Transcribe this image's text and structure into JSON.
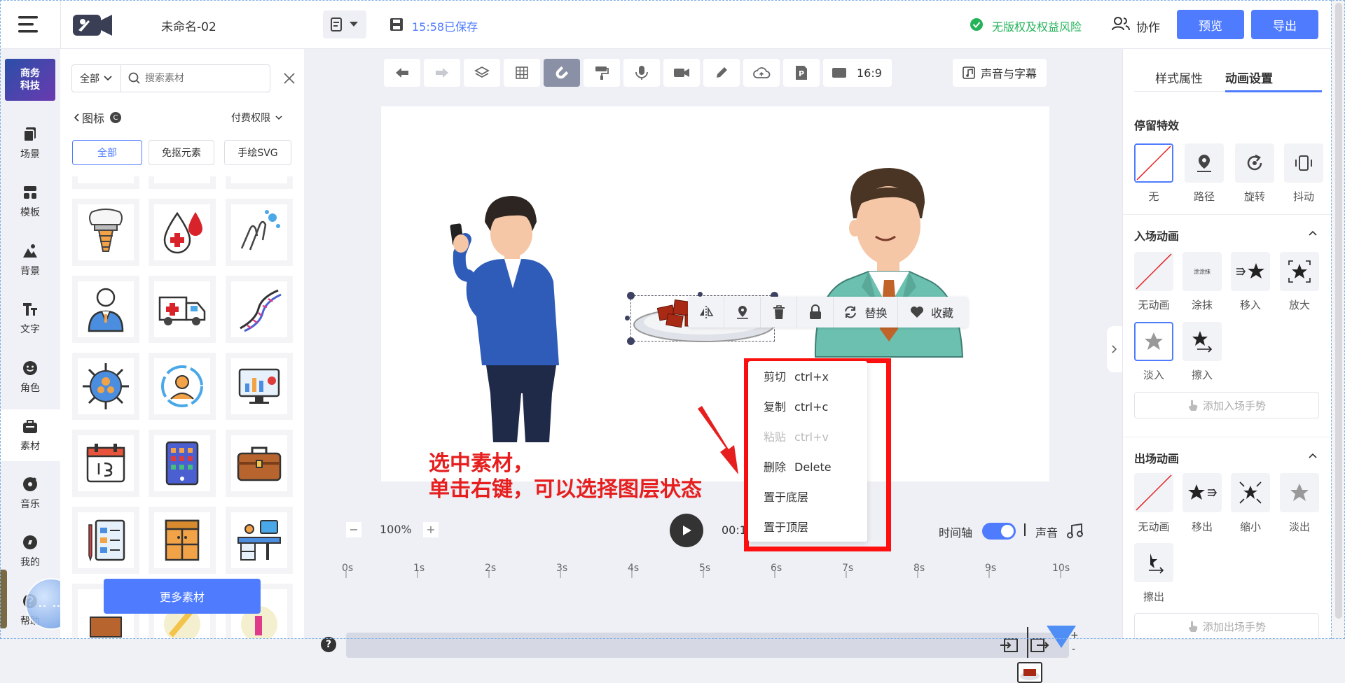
{
  "header": {
    "doc_title": "未命名-02",
    "save_status": "15:58已保存",
    "copyright_status": "无版权及权益风险",
    "collab_label": "协作",
    "preview_label": "预览",
    "export_label": "导出"
  },
  "nav": {
    "brand_line1": "商务",
    "brand_line2": "科技",
    "items": [
      {
        "label": "场景"
      },
      {
        "label": "模板"
      },
      {
        "label": "背景"
      },
      {
        "label": "文字"
      },
      {
        "label": "角色"
      },
      {
        "label": "素材"
      },
      {
        "label": "音乐"
      },
      {
        "label": "我的"
      },
      {
        "label": "帮助"
      }
    ]
  },
  "panel": {
    "category_select": "全部",
    "search_placeholder": "搜索素材",
    "back_label": "图标",
    "category_badge": "C",
    "paid_filter": "付费权限",
    "filters": [
      "全部",
      "免抠元素",
      "手绘SVG"
    ],
    "more_button": "更多素材"
  },
  "toolbar": {
    "aspect_ratio": "16:9",
    "sound_subtitle": "声音与字幕"
  },
  "element_toolbar": {
    "replace_label": "替换",
    "favorite_label": "收藏"
  },
  "context_menu": {
    "items": [
      {
        "label": "剪切",
        "shortcut": "ctrl+x"
      },
      {
        "label": "复制",
        "shortcut": "ctrl+c"
      },
      {
        "label": "粘贴",
        "shortcut": "ctrl+v"
      },
      {
        "label": "删除",
        "shortcut": "Delete"
      },
      {
        "label": "置于底层",
        "shortcut": ""
      },
      {
        "label": "置于顶层",
        "shortcut": ""
      }
    ]
  },
  "annotation": {
    "line1": "选中素材，",
    "line2": "单击右键，可以选择图层状态"
  },
  "playback": {
    "zoom": "100%",
    "time": "00:1",
    "timeline_label": "时间轴",
    "sound_label": "声音"
  },
  "timeline": {
    "ticks": [
      "0s",
      "1s",
      "2s",
      "3s",
      "4s",
      "5s",
      "6s",
      "7s",
      "8s",
      "9s",
      "10s"
    ],
    "plus": "+",
    "minus": "-"
  },
  "right": {
    "tabs": [
      "样式属性",
      "动画设置"
    ],
    "stay_title": "停留特效",
    "stay_effects": [
      "无",
      "路径",
      "旋转",
      "抖动"
    ],
    "enter_title": "入场动画",
    "enter_effects": [
      "无动画",
      "涂抹",
      "移入",
      "放大",
      "淡入",
      "擦入"
    ],
    "enter_thumb_text": "涂涂抹",
    "add_enter_gesture": "添加入场手势",
    "exit_title": "出场动画",
    "exit_effects": [
      "无动画",
      "移出",
      "缩小",
      "淡出",
      "擦出"
    ],
    "add_exit_gesture": "添加出场手势"
  },
  "colors": {
    "accent": "#4f7cff",
    "annotation_red": "#e61e1e",
    "safe_green": "#25b35a"
  }
}
